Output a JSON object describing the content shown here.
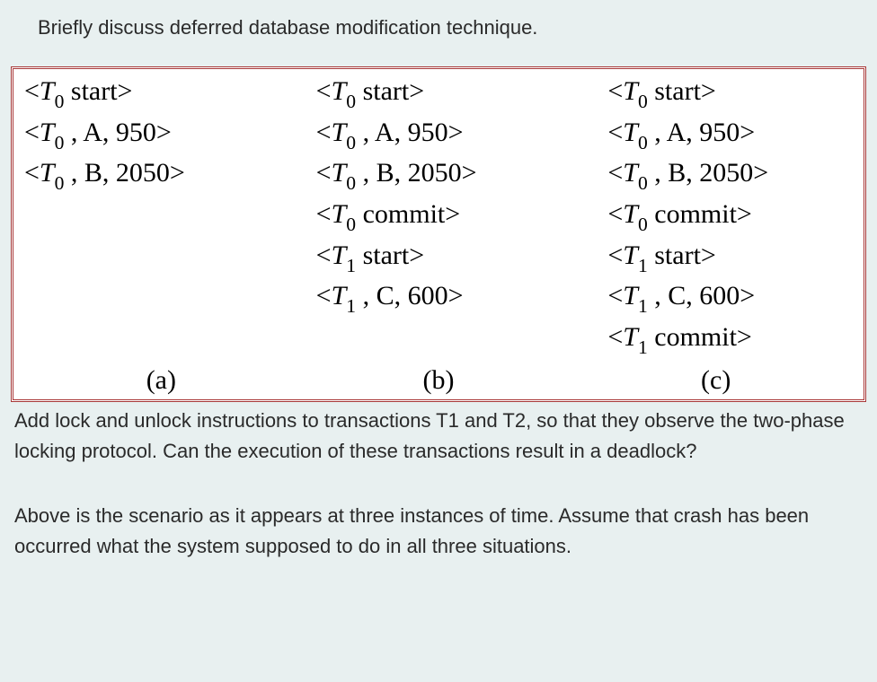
{
  "header": {
    "question": "Briefly discuss deferred database modification technique."
  },
  "logTable": {
    "columns": {
      "a": {
        "label": "(a)",
        "entries": [
          {
            "t": "T",
            "sub": "0",
            "rest": " start"
          },
          {
            "t": "T",
            "sub": "0",
            "rest": " , A, 950"
          },
          {
            "t": "T",
            "sub": "0",
            "rest": " , B, 2050"
          }
        ]
      },
      "b": {
        "label": "(b)",
        "entries": [
          {
            "t": "T",
            "sub": "0",
            "rest": " start"
          },
          {
            "t": "T",
            "sub": "0",
            "rest": " , A, 950"
          },
          {
            "t": "T",
            "sub": "0",
            "rest": " , B, 2050"
          },
          {
            "t": "T",
            "sub": "0",
            "rest": " commit"
          },
          {
            "t": "T",
            "sub": "1",
            "rest": " start"
          },
          {
            "t": "T",
            "sub": "1",
            "rest": " , C, 600"
          }
        ]
      },
      "c": {
        "label": "(c)",
        "entries": [
          {
            "t": "T",
            "sub": "0",
            "rest": " start"
          },
          {
            "t": "T",
            "sub": "0",
            "rest": " , A, 950"
          },
          {
            "t": "T",
            "sub": "0",
            "rest": " , B, 2050"
          },
          {
            "t": "T",
            "sub": "0",
            "rest": " commit"
          },
          {
            "t": "T",
            "sub": "1",
            "rest": " start"
          },
          {
            "t": "T",
            "sub": "1",
            "rest": " , C, 600"
          },
          {
            "t": "T",
            "sub": "1",
            "rest": " commit"
          }
        ]
      }
    }
  },
  "body": {
    "p1": "Add lock and unlock instructions to transactions T1 and T2, so that they observe the two-phase locking protocol. Can the execution of these transactions result in a deadlock?",
    "p2": "Above is the scenario as it appears at three instances of time. Assume that crash has been occurred what the system supposed to do in all three situations."
  }
}
